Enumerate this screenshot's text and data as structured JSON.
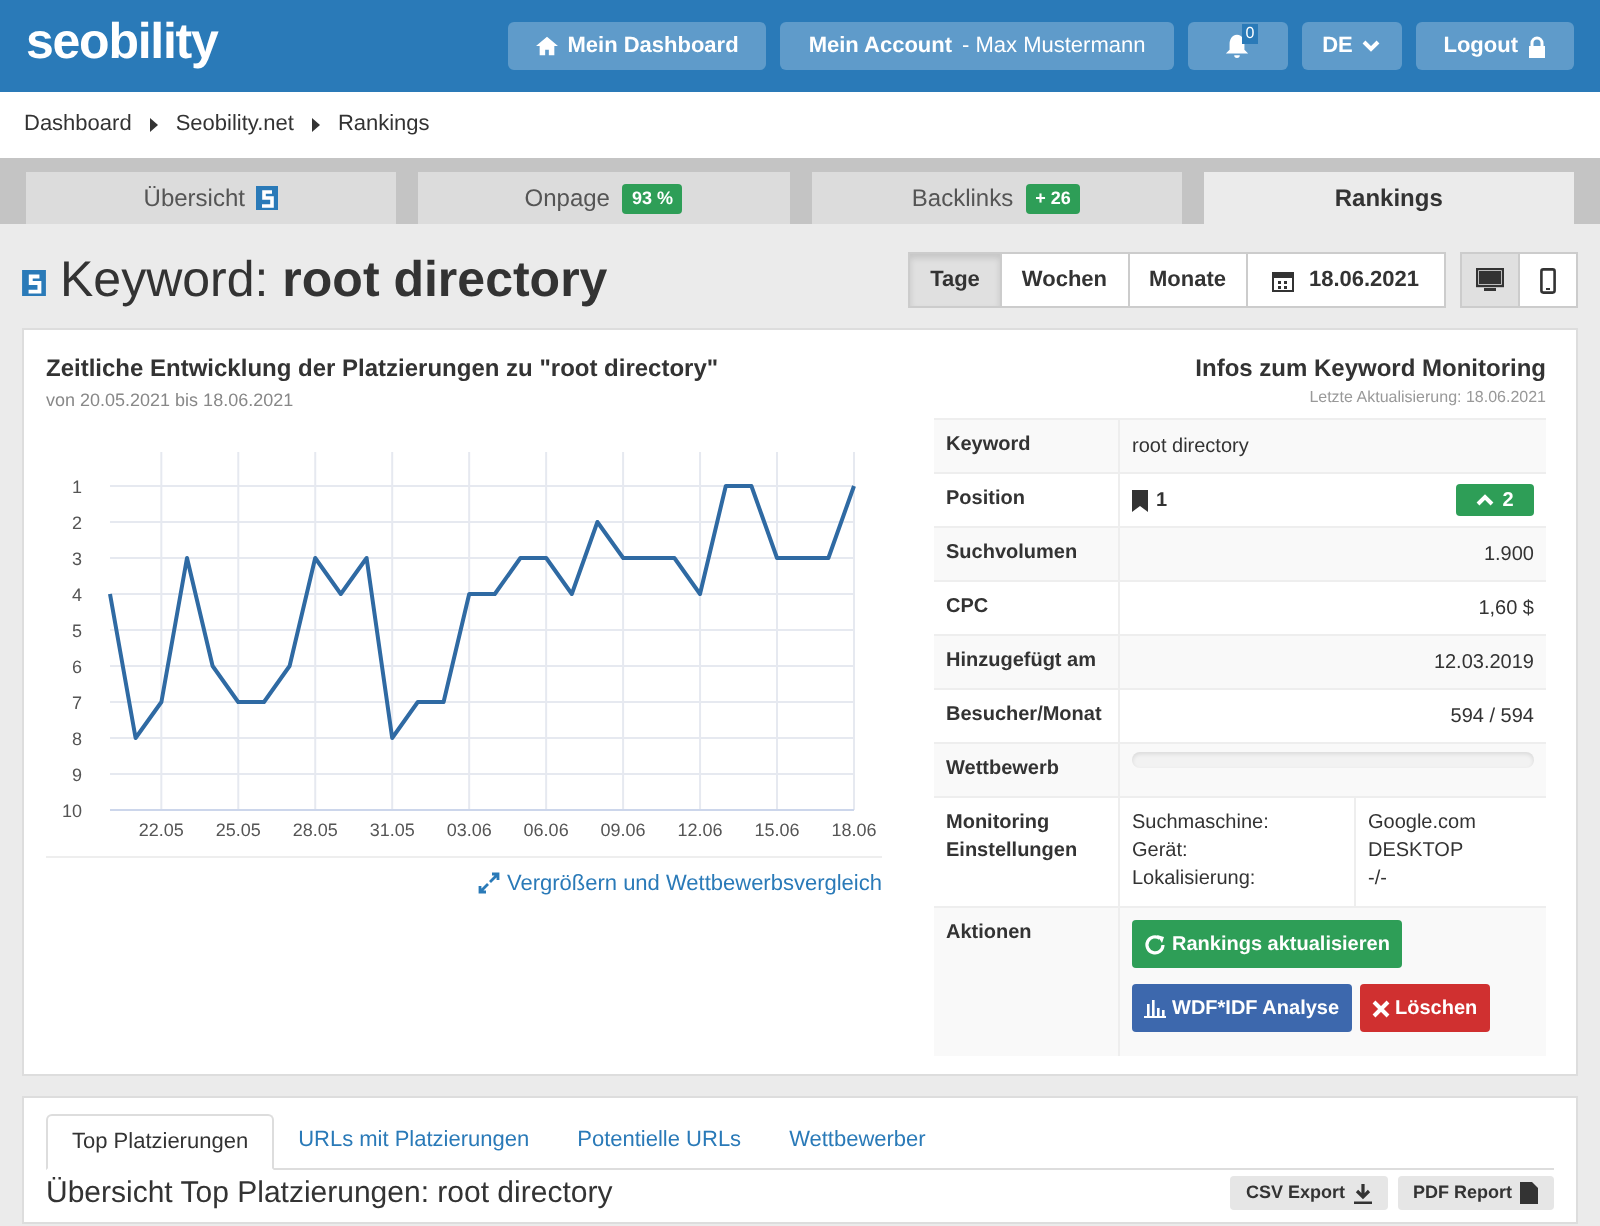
{
  "header": {
    "logo": "seobility",
    "nav": [
      {
        "kind": "home",
        "label": "Mein Dashboard"
      },
      {
        "kind": "account",
        "label": "Mein Account",
        "sub": "- Max Mustermann"
      },
      {
        "kind": "bell",
        "badge": "0"
      },
      {
        "kind": "lang",
        "label": "DE"
      },
      {
        "kind": "logout",
        "label": "Logout"
      }
    ]
  },
  "breadcrumb": [
    "Dashboard",
    "Seobility.net",
    "Rankings"
  ],
  "tabs": [
    {
      "label": "Übersicht",
      "kind": "logo",
      "selected": false
    },
    {
      "label": "Onpage",
      "badge": "93 %",
      "kind": "badge",
      "selected": false
    },
    {
      "label": "Backlinks",
      "badge": "+ 26",
      "kind": "badge",
      "selected": false
    },
    {
      "label": "Rankings",
      "kind": "plain",
      "selected": true
    }
  ],
  "title": {
    "prefix": "Keyword:",
    "keyword": "root directory"
  },
  "periods": [
    {
      "label": "Tage",
      "selected": true
    },
    {
      "label": "Wochen",
      "selected": false
    },
    {
      "label": "Monate",
      "selected": false
    }
  ],
  "date": "18.06.2021",
  "devices": [
    {
      "kind": "desktop",
      "selected": true
    },
    {
      "kind": "mobile",
      "selected": false
    }
  ],
  "chart_panel": {
    "title": "Zeitliche Entwicklung der Platzierungen zu \"root directory\"",
    "subtitle": "von 20.05.2021 bis 18.06.2021",
    "link": "Vergrößern und Wettbewerbsvergleich",
    "chart_data": {
      "type": "line",
      "grid": true,
      "categories": [
        null,
        null,
        "22.05",
        null,
        null,
        "25.05",
        null,
        null,
        "28.05",
        null,
        null,
        "31.05",
        null,
        null,
        "03.06",
        null,
        null,
        "06.06",
        null,
        null,
        "09.06",
        null,
        null,
        "12.06",
        null,
        null,
        "15.06",
        null,
        null,
        "18.06"
      ],
      "series": [
        {
          "color": "#2f6aa3",
          "values": [
            4,
            8,
            7,
            3,
            6,
            7,
            7,
            6,
            3,
            4,
            3,
            8,
            7,
            7,
            4,
            4,
            3,
            3,
            4,
            2,
            3,
            3,
            3,
            4,
            1,
            1,
            3,
            3,
            3,
            1
          ]
        }
      ],
      "ylim": [
        10,
        1
      ],
      "yticks": [
        1,
        2,
        3,
        4,
        5,
        6,
        7,
        8,
        9,
        10
      ]
    }
  },
  "info": {
    "title": "Infos zum Keyword Monitoring",
    "updated": "Letzte Aktualisierung: 18.06.2021",
    "rows": [
      {
        "kind": "text",
        "label": "Keyword",
        "value": "root directory"
      },
      {
        "kind": "position",
        "label": "Position",
        "value": "1",
        "change": "2"
      },
      {
        "kind": "number",
        "label": "Suchvolumen",
        "value": "1.900"
      },
      {
        "kind": "number",
        "label": "CPC",
        "value": "1,60 $"
      },
      {
        "kind": "number",
        "label": "Hinzugefügt am",
        "value": "12.03.2019"
      },
      {
        "kind": "number",
        "label": "Besucher/Monat",
        "value": "594 / 594"
      },
      {
        "kind": "progress",
        "label": "Wettbewerb",
        "level": 0
      },
      {
        "kind": "settings",
        "label": "Monitoring Einstellungen",
        "keys": [
          "Suchmaschine:",
          "Gerät:",
          "Lokalisierung:"
        ],
        "values": [
          "Google.com",
          "DESKTOP",
          "-/-"
        ]
      },
      {
        "kind": "actions",
        "label": "Aktionen",
        "buttons": [
          {
            "kind": "refresh",
            "label": "Rankings aktualisieren"
          },
          {
            "kind": "analysis",
            "label": "WDF*IDF Analyse"
          },
          {
            "kind": "delete",
            "label": "Löschen"
          }
        ]
      }
    ]
  },
  "bottom": {
    "tabs": [
      {
        "label": "Top Platzierungen",
        "selected": true
      },
      {
        "label": "URLs mit Platzierungen",
        "selected": false
      },
      {
        "label": "Potentielle URLs",
        "selected": false
      },
      {
        "label": "Wettbewerber",
        "selected": false
      }
    ],
    "heading": "Übersicht Top Platzierungen: root directory",
    "buttons": [
      {
        "kind": "download",
        "label": "CSV Export"
      },
      {
        "kind": "file",
        "label": "PDF Report"
      }
    ]
  }
}
